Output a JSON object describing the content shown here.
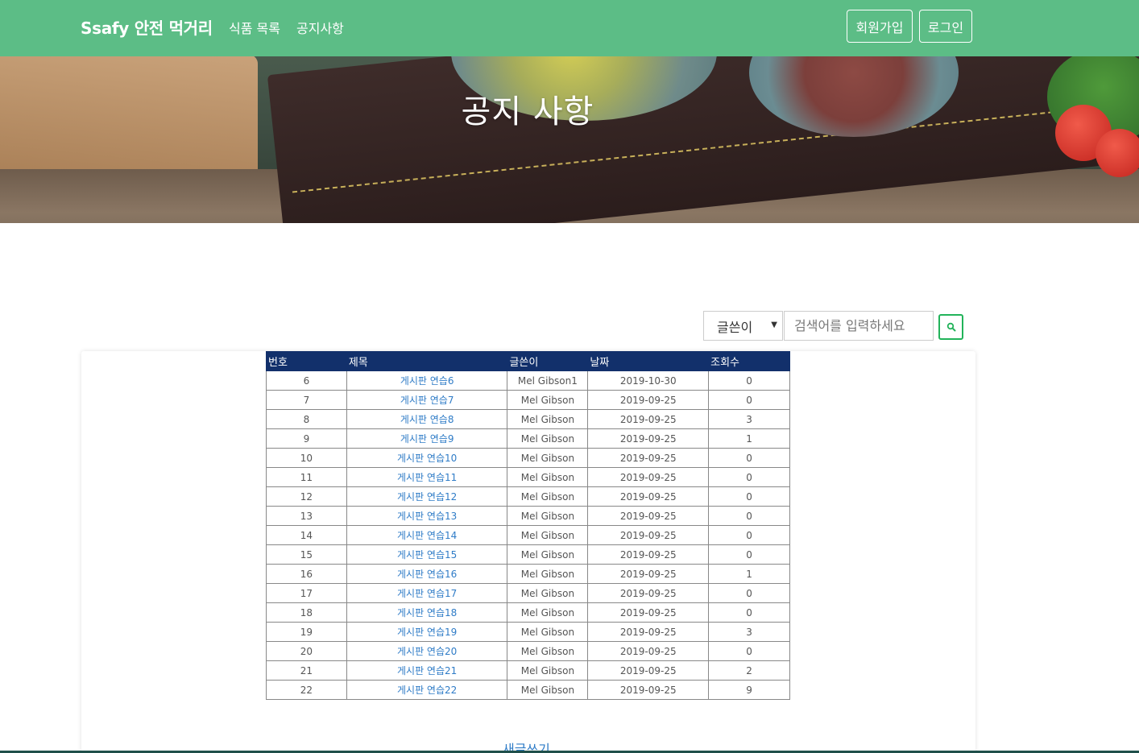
{
  "navbar": {
    "brand": "Ssafy 안전 먹거리",
    "links": [
      "식품 목록",
      "공지사항"
    ],
    "signup": "회원가입",
    "login": "로그인"
  },
  "hero": {
    "title": "공지 사항"
  },
  "search": {
    "select_value": "글쓴이",
    "placeholder": "검색어를 입력하세요"
  },
  "table": {
    "headers": [
      "번호",
      "제목",
      "글쓴이",
      "날짜",
      "조회수"
    ],
    "rows": [
      [
        "6",
        "게시판 연습6",
        "Mel Gibson1",
        "2019-10-30",
        "0"
      ],
      [
        "7",
        "게시판 연습7",
        "Mel Gibson",
        "2019-09-25",
        "0"
      ],
      [
        "8",
        "게시판 연습8",
        "Mel Gibson",
        "2019-09-25",
        "3"
      ],
      [
        "9",
        "게시판 연습9",
        "Mel Gibson",
        "2019-09-25",
        "1"
      ],
      [
        "10",
        "게시판 연습10",
        "Mel Gibson",
        "2019-09-25",
        "0"
      ],
      [
        "11",
        "게시판 연습11",
        "Mel Gibson",
        "2019-09-25",
        "0"
      ],
      [
        "12",
        "게시판 연습12",
        "Mel Gibson",
        "2019-09-25",
        "0"
      ],
      [
        "13",
        "게시판 연습13",
        "Mel Gibson",
        "2019-09-25",
        "0"
      ],
      [
        "14",
        "게시판 연습14",
        "Mel Gibson",
        "2019-09-25",
        "0"
      ],
      [
        "15",
        "게시판 연습15",
        "Mel Gibson",
        "2019-09-25",
        "0"
      ],
      [
        "16",
        "게시판 연습16",
        "Mel Gibson",
        "2019-09-25",
        "1"
      ],
      [
        "17",
        "게시판 연습17",
        "Mel Gibson",
        "2019-09-25",
        "0"
      ],
      [
        "18",
        "게시판 연습18",
        "Mel Gibson",
        "2019-09-25",
        "0"
      ],
      [
        "19",
        "게시판 연습19",
        "Mel Gibson",
        "2019-09-25",
        "3"
      ],
      [
        "20",
        "게시판 연습20",
        "Mel Gibson",
        "2019-09-25",
        "0"
      ],
      [
        "21",
        "게시판 연습21",
        "Mel Gibson",
        "2019-09-25",
        "2"
      ],
      [
        "22",
        "게시판 연습22",
        "Mel Gibson",
        "2019-09-25",
        "9"
      ]
    ]
  },
  "write_link": "새글쓰기",
  "colors": {
    "navbar": "#5cbd86",
    "table_header": "#12306b",
    "link": "#2f7cc7",
    "search_button_border": "#22b35a"
  },
  "icons": {
    "search_button": "search-icon",
    "select": "caret-down-icon"
  }
}
